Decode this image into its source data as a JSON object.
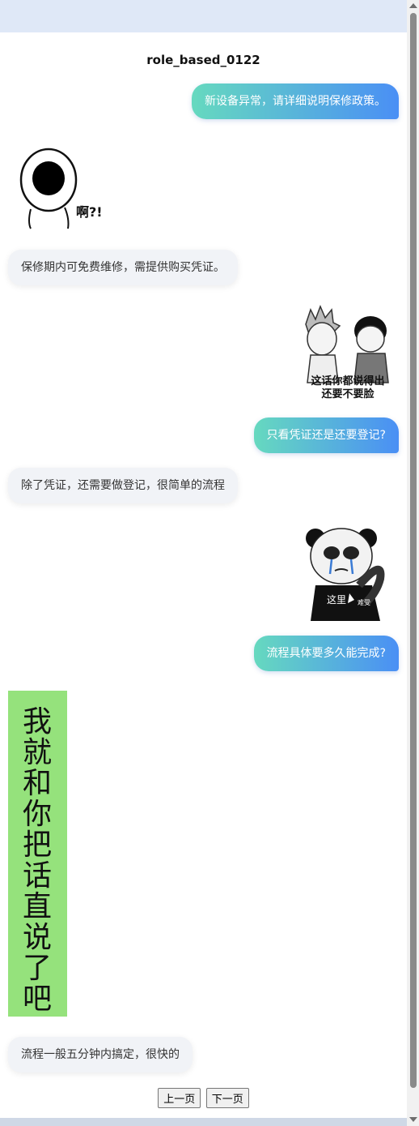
{
  "title": "role_based_0122",
  "messages": [
    {
      "role": "user",
      "text": "新设备异常，请详细说明保修政策。"
    },
    {
      "role": "sticker",
      "caption": "啊?!"
    },
    {
      "role": "bot",
      "text": "保修期内可免费维修，需提供购买凭证。"
    },
    {
      "role": "sticker",
      "caption_line1": "这话你都说得出",
      "caption_line2": "还要不要脸"
    },
    {
      "role": "user",
      "text": "只看凭证还是还要登记?"
    },
    {
      "role": "bot",
      "text": "除了凭证，还需要做登记，很简单的流程"
    },
    {
      "role": "sticker",
      "caption_main": "这里",
      "caption_small": "难受"
    },
    {
      "role": "user",
      "text": "流程具体要多久能完成?"
    },
    {
      "role": "sticker",
      "chars": [
        "我",
        "就",
        "和",
        "你",
        "把",
        "话",
        "直",
        "说",
        "了",
        "吧"
      ]
    },
    {
      "role": "bot",
      "text": "流程一般五分钟内搞定，很快的"
    }
  ],
  "pager": {
    "prev": "上一页",
    "next": "下一页"
  },
  "colors": {
    "user_gradient_start": "#66d9bf",
    "user_gradient_end": "#4a8ff5",
    "bot_bg": "#f1f3f7",
    "sticker_green": "#95e27c"
  }
}
